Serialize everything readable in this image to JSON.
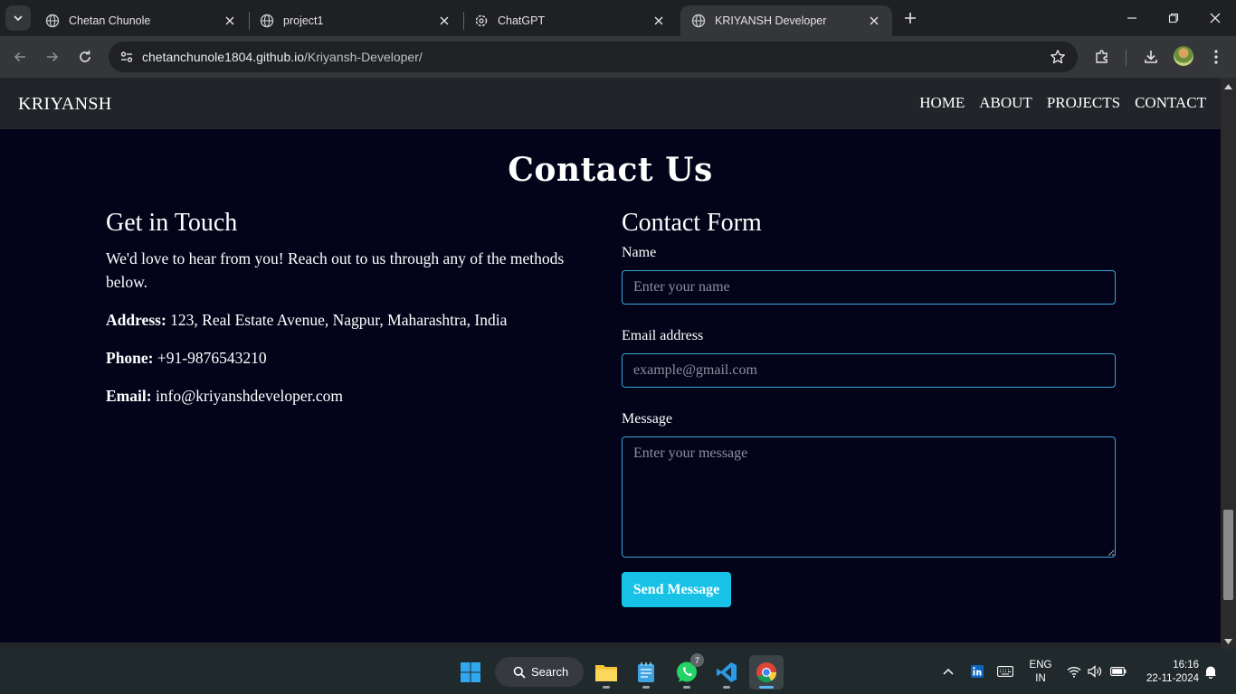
{
  "browser": {
    "tabs": [
      {
        "title": "Chetan Chunole",
        "active": false
      },
      {
        "title": "project1",
        "active": false
      },
      {
        "title": "ChatGPT",
        "active": false
      },
      {
        "title": "KRIYANSH Developer",
        "active": true
      }
    ],
    "url_host": "chetanchunole1804.github.io",
    "url_path": "/Kriyansh-Developer/"
  },
  "site": {
    "brand": "KRIYANSH",
    "nav": [
      "HOME",
      "ABOUT",
      "PROJECTS",
      "CONTACT"
    ]
  },
  "contact": {
    "title": "Contact Us",
    "touch": {
      "heading": "Get in Touch",
      "intro": "We'd love to hear from you! Reach out to us through any of the methods below.",
      "address_label": "Address:",
      "address_value": " 123, Real Estate Avenue, Nagpur, Maharashtra, India",
      "phone_label": "Phone:",
      "phone_value": " +91-9876543210",
      "email_label": "Email:",
      "email_value": " info@kriyanshdeveloper.com"
    },
    "form": {
      "heading": "Contact Form",
      "name_label": "Name",
      "name_placeholder": "Enter your name",
      "email_label": "Email address",
      "email_placeholder": "example@gmail.com",
      "message_label": "Message",
      "message_placeholder": "Enter your message",
      "submit_label": "Send Message"
    }
  },
  "taskbar": {
    "search_label": "Search",
    "whatsapp_badge": "7",
    "lang_line1": "ENG",
    "lang_line2": "IN",
    "time": "16:16",
    "date": "22-11-2024"
  },
  "colors": {
    "page_bg": "#03041a",
    "navbar_bg": "#212529",
    "input_border": "#3aa4d6",
    "button_bg": "#17c2e6"
  }
}
